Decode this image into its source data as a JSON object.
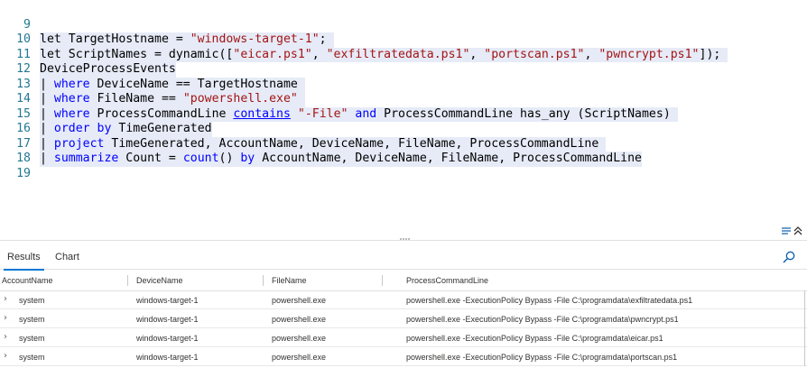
{
  "editor": {
    "lines": [
      {
        "n": "9"
      },
      {
        "n": "10"
      },
      {
        "n": "11"
      },
      {
        "n": "12"
      },
      {
        "n": "13"
      },
      {
        "n": "14"
      },
      {
        "n": "15"
      },
      {
        "n": "16"
      },
      {
        "n": "17"
      },
      {
        "n": "18"
      },
      {
        "n": "19"
      }
    ],
    "l9": {
      "a": "let TargetHostname = ",
      "b": "\"windows-target-1\"",
      "c": ";"
    },
    "l10": {
      "a": "let ScriptNames = dynamic([",
      "b": "\"eicar.ps1\"",
      "c": ", ",
      "d": "\"exfiltratedata.ps1\"",
      "e": ", ",
      "f": "\"portscan.ps1\"",
      "g": ", ",
      "h": "\"pwncrypt.ps1\"",
      "i": "]);"
    },
    "l11": {
      "a": "DeviceProcessEvents"
    },
    "l12": {
      "pipe": "| ",
      "kw": "where",
      "a": " DeviceName == TargetHostname"
    },
    "l13": {
      "pipe": "| ",
      "kw": "where",
      "a": " FileName == ",
      "b": "\"powershell.exe\""
    },
    "l14": {
      "pipe": "| ",
      "kw": "where",
      "a": " ProcessCommandLine ",
      "fn": "contains",
      "b": " ",
      "s": "\"-File\"",
      "c": " ",
      "and": "and",
      "d": " ProcessCommandLine has_any (ScriptNames)"
    },
    "l15": {
      "pipe": "| ",
      "kw": "order",
      "a": " ",
      "kw2": "by",
      "b": " TimeGenerated"
    },
    "l16": {
      "pipe": "| ",
      "kw": "project",
      "a": " TimeGenerated, AccountName, DeviceName, FileName, ProcessCommandLine"
    },
    "l17": {
      "pipe": "| ",
      "kw": "summarize",
      "a": " Count = ",
      "fn": "count",
      "b": "() ",
      "kw2": "by",
      "c": " AccountName, DeviceName, FileName, ProcessCommandLine"
    }
  },
  "tabs": [
    {
      "label": "Results"
    },
    {
      "label": "Chart"
    }
  ],
  "grid": {
    "columns": [
      "AccountName",
      "DeviceName",
      "FileName",
      "ProcessCommandLine"
    ],
    "rows": [
      [
        "system",
        "windows-target-1",
        "powershell.exe",
        "powershell.exe -ExecutionPolicy Bypass -File C:\\programdata\\exfiltratedata.ps1"
      ],
      [
        "system",
        "windows-target-1",
        "powershell.exe",
        "powershell.exe -ExecutionPolicy Bypass -File C:\\programdata\\pwncrypt.ps1"
      ],
      [
        "system",
        "windows-target-1",
        "powershell.exe",
        "powershell.exe -ExecutionPolicy Bypass -File C:\\programdata\\eicar.ps1"
      ],
      [
        "system",
        "windows-target-1",
        "powershell.exe",
        "powershell.exe -ExecutionPolicy Bypass -File C:\\programdata\\portscan.ps1"
      ]
    ]
  },
  "icons": {
    "search": "search-icon",
    "collapse": "collapse-panel-icon",
    "expand_row": "chevron-right-icon",
    "grip": "splitter-grip-icon"
  },
  "colors": {
    "keyword": "#0000ff",
    "string": "#a31515",
    "line_number": "#237893",
    "selection": "#e6ebf7",
    "accent": "#0078d4"
  }
}
